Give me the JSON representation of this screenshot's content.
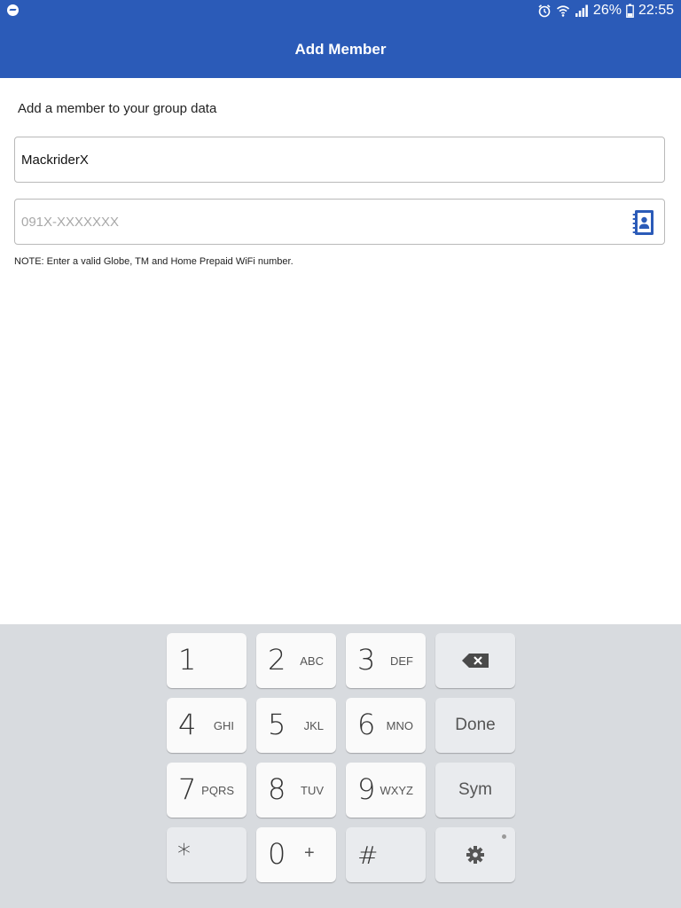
{
  "status_bar": {
    "battery": "26%",
    "time": "22:55",
    "icons": [
      "messenger-icon",
      "alarm-icon",
      "wifi-icon",
      "signal-icon",
      "battery-icon"
    ]
  },
  "app_bar": {
    "title": "Add Member"
  },
  "form": {
    "instruction": "Add a member to your group data",
    "name_value": "MackriderX",
    "number_value": "",
    "number_placeholder": "091X-XXXXXXX",
    "note": "NOTE: Enter a valid Globe, TM and Home Prepaid WiFi number."
  },
  "keyboard": {
    "keys": {
      "k1": {
        "num": "1",
        "letters": ""
      },
      "k2": {
        "num": "2",
        "letters": "ABC"
      },
      "k3": {
        "num": "3",
        "letters": "DEF"
      },
      "k4": {
        "num": "4",
        "letters": "GHI"
      },
      "k5": {
        "num": "5",
        "letters": "JKL"
      },
      "k6": {
        "num": "6",
        "letters": "MNO"
      },
      "k7": {
        "num": "7",
        "letters": "PQRS"
      },
      "k8": {
        "num": "8",
        "letters": "TUV"
      },
      "k9": {
        "num": "9",
        "letters": "WXYZ"
      },
      "k0": {
        "num": "0",
        "letters": "+"
      },
      "star": "*",
      "hash": "#"
    },
    "done_label": "Done",
    "sym_label": "Sym"
  },
  "colors": {
    "brand": "#2b5bb8",
    "keyboard_bg": "#d8dbdf",
    "contact_icon": "#2b5bb8"
  }
}
